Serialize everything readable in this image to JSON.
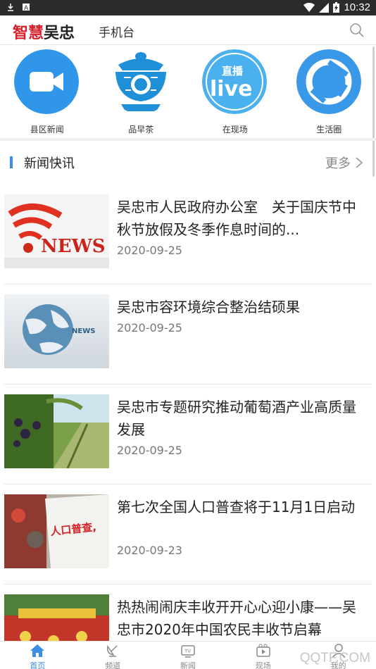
{
  "status_bar": {
    "time": "10:32"
  },
  "header": {
    "logo_part1": "智慧",
    "logo_part2": "吴忠",
    "subtitle": "手机台"
  },
  "tiles": [
    {
      "label": "县区新闻",
      "icon": "video-camera-icon",
      "color": "#2f96ea"
    },
    {
      "label": "品早茶",
      "icon": "tea-cup-icon",
      "color": "#1f8fd8"
    },
    {
      "label": "在现场",
      "icon": "live-broadcast-icon",
      "color": "#4bb1ee",
      "badge": "直播",
      "text": "live"
    },
    {
      "label": "生活圈",
      "icon": "life-circle-icon",
      "color": "#3a98e8"
    }
  ],
  "section": {
    "title": "新闻快讯",
    "more": "更多"
  },
  "news": [
    {
      "title": "吴忠市人民政府办公室　关于国庆节中秋节放假及冬季作息时间的...",
      "date": "2020-09-25",
      "thumb": "news-red",
      "thumb_text": "NEWS"
    },
    {
      "title": "吴忠市容环境综合整治结硕果",
      "date": "2020-09-25",
      "thumb": "news-globe",
      "thumb_text": "NEWS"
    },
    {
      "title": "吴忠市专题研究推动葡萄酒产业高质量发展",
      "date": "2020-09-25",
      "thumb": "vineyard"
    },
    {
      "title": "第七次全国人口普查将于11月1日启动",
      "date": "2020-09-23",
      "thumb": "census",
      "thumb_text": "人口普查,"
    },
    {
      "title": "热热闹闹庆丰收开开心心迎小康——吴忠市2020年中国农民丰收节启幕",
      "date": "",
      "thumb": "festival"
    }
  ],
  "bottom_nav": [
    {
      "label": "首页",
      "icon": "home-icon",
      "active": true
    },
    {
      "label": "频道",
      "icon": "satellite-icon",
      "active": false
    },
    {
      "label": "新闻",
      "icon": "tv-icon",
      "active": false
    },
    {
      "label": "现场",
      "icon": "live-video-icon",
      "active": false
    },
    {
      "label": "我的",
      "icon": "user-icon",
      "active": false
    }
  ],
  "watermark": "QQTF.COM"
}
